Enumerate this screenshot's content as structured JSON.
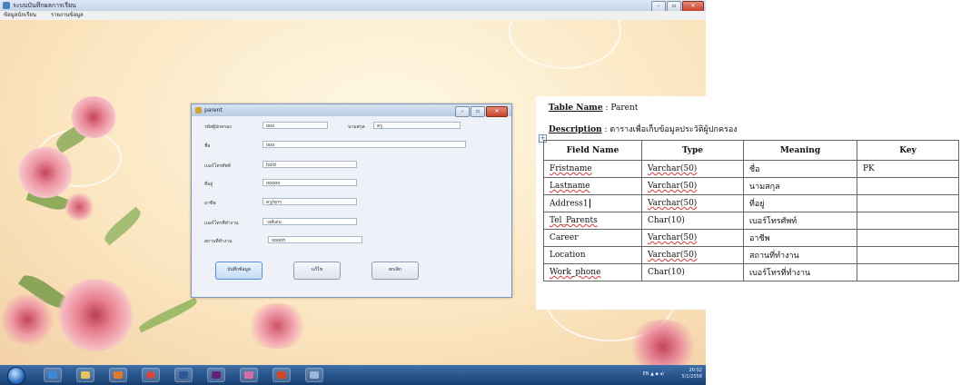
{
  "app": {
    "window_title": "ระบบบันทึกผลการเรียน",
    "menu": [
      "ข้อมูลนักเรียน",
      "รายงานข้อมูล"
    ]
  },
  "parent_form": {
    "title": "parent",
    "fields": {
      "parent_id": {
        "label": "รหัสผู้ปกครอง",
        "value": "ooo"
      },
      "lastname": {
        "label": "นามสกุล",
        "value": "ครู"
      },
      "name": {
        "label": "ชื่อ",
        "value": "ooo"
      },
      "phone": {
        "label": "เบอร์โทรศัพท์",
        "value": "hold"
      },
      "address": {
        "label": "ที่อยู่",
        "value": "ooooo"
      },
      "career": {
        "label": "อาชีพ",
        "value": "ครู/ทุกๆ"
      },
      "work_phone": {
        "label": "เบอร์โทรที่ทำงาน",
        "value": "วงศ์เด่น"
      },
      "location": {
        "label": "สถานที่ทำงาน",
        "value": "ooooh"
      }
    },
    "buttons": {
      "save": "บันทึกข้อมูล",
      "edit": "แก้ไข",
      "cancel": "ยกเลิก"
    }
  },
  "taskbar": {
    "time": "20:52",
    "date": "5/1/2558",
    "tray": "EN"
  },
  "doc": {
    "table_name_label": "Table Name",
    "table_name_value": ": Parent",
    "description_label": "Description",
    "description_value": ": ตารางเพื่อเก็บข้อมูลประวัติผู้ปกครอง",
    "headers": [
      "Field Name",
      "Type",
      "Meaning",
      "Key"
    ],
    "rows": [
      [
        "Fristname",
        "Varchar(50)",
        "ชื่อ",
        "PK"
      ],
      [
        "Lastname",
        "Varchar(50)",
        "นามสกุล",
        ""
      ],
      [
        "Address1",
        "Varchar(50)",
        "ที่อยู่",
        ""
      ],
      [
        "Tel_Parents",
        "Char(10)",
        "เบอร์โทรศัพท์",
        ""
      ],
      [
        "Career",
        "Varchar(50)",
        "อาชีพ",
        ""
      ],
      [
        "Location",
        "Varchar(50)",
        "สถานที่ทำงาน",
        ""
      ],
      [
        "Work_phone",
        "Char(10)",
        "เบอร์โทรที่ทำงาน",
        ""
      ]
    ]
  }
}
